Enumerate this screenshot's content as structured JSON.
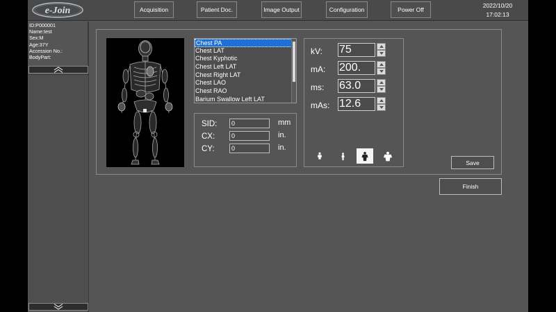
{
  "app": {
    "logo_text": "e-Join"
  },
  "nav": {
    "items": [
      {
        "label": "Acquisition"
      },
      {
        "label": "Patient Doc."
      },
      {
        "label": "Image Output"
      },
      {
        "label": "Configuration"
      },
      {
        "label": "Power Off"
      }
    ]
  },
  "clock": {
    "date": "2022/10/20",
    "time": "17:02:13"
  },
  "patient": {
    "id": "ID:P000001",
    "name": "Name:test",
    "sex": "Sex:M",
    "age": "Age:37Y",
    "accession": "Accession No.:",
    "bodypart": "BodyPart:"
  },
  "protocols": {
    "selected": "Chest PA",
    "items": [
      "Chest PA",
      "Chest LAT",
      "Chest Kyphotic",
      "Chest Left LAT",
      "Chest Right LAT",
      "Chest LAO",
      "Chest RAO",
      "Barium Swallow Left LAT"
    ]
  },
  "geometry": {
    "sid": {
      "label": "SID:",
      "value": "0",
      "unit": "mm"
    },
    "cx": {
      "label": "CX:",
      "value": "0",
      "unit": "in."
    },
    "cy": {
      "label": "CY:",
      "value": "0",
      "unit": "in."
    }
  },
  "exposure": {
    "kv": {
      "label": "kV:",
      "value": "75"
    },
    "ma": {
      "label": "mA:",
      "value": "200."
    },
    "ms": {
      "label": "ms:",
      "value": "63.0"
    },
    "mas": {
      "label": "mAs:",
      "value": "12.6"
    }
  },
  "body_sizes": {
    "items": [
      "child-icon",
      "slim-person-icon",
      "medium-person-icon",
      "large-person-icon"
    ],
    "selected": "medium-person-icon"
  },
  "buttons": {
    "save": "Save",
    "finish": "Finish"
  },
  "colors": {
    "selection": "#1e6fd6",
    "background": "#555555"
  }
}
